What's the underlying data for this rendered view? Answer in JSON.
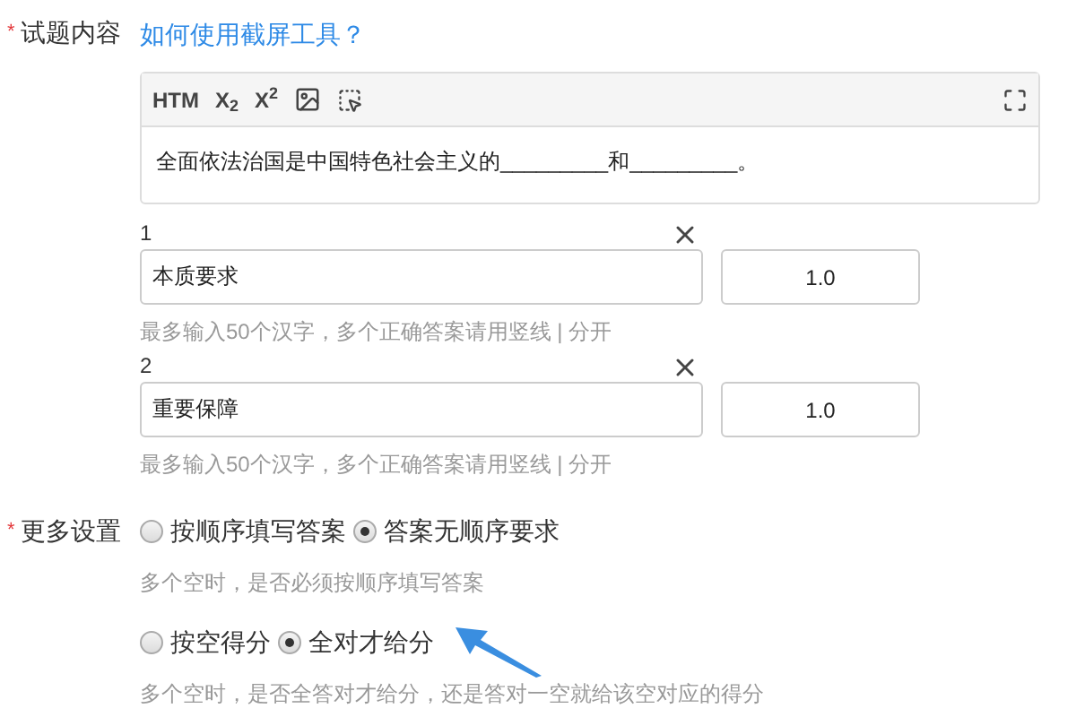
{
  "content": {
    "label": "试题内容",
    "required_mark": "*",
    "help_link": "如何使用截屏工具？",
    "toolbar": [
      {
        "kind": "text",
        "text": "HTM"
      },
      {
        "kind": "text",
        "text": "X$_{2}$"
      },
      {
        "kind": "text",
        "text": "X$^{2}$"
      },
      {
        "kind": "image"
      },
      {
        "kind": "select"
      }
    ],
    "body": "全面依法治国是中国特色社会主义的_________和_________。"
  },
  "answers": [
    {
      "number": "1",
      "value": "本质要求",
      "score": "1.0",
      "hint": "最多输入50个汉字，多个正确答案请用竖线 | 分开"
    },
    {
      "number": "2",
      "value": "重要保障",
      "score": "1.0",
      "hint": "最多输入50个汉字，多个正确答案请用竖线 | 分开"
    }
  ],
  "settings": {
    "label": "更多设置",
    "required_mark": "*",
    "groups": [
      {
        "options": [
          {
            "label": "按顺序填写答案",
            "selected": false
          },
          {
            "label": "答案无顺序要求",
            "selected": true
          }
        ],
        "hint": "多个空时，是否必须按顺序填写答案"
      },
      {
        "options": [
          {
            "label": "按空得分",
            "selected": false
          },
          {
            "label": "全对才给分",
            "selected": true
          }
        ],
        "hint": "多个空时，是否全答对才给分，还是答对一空就给该空对应的得分"
      }
    ]
  }
}
